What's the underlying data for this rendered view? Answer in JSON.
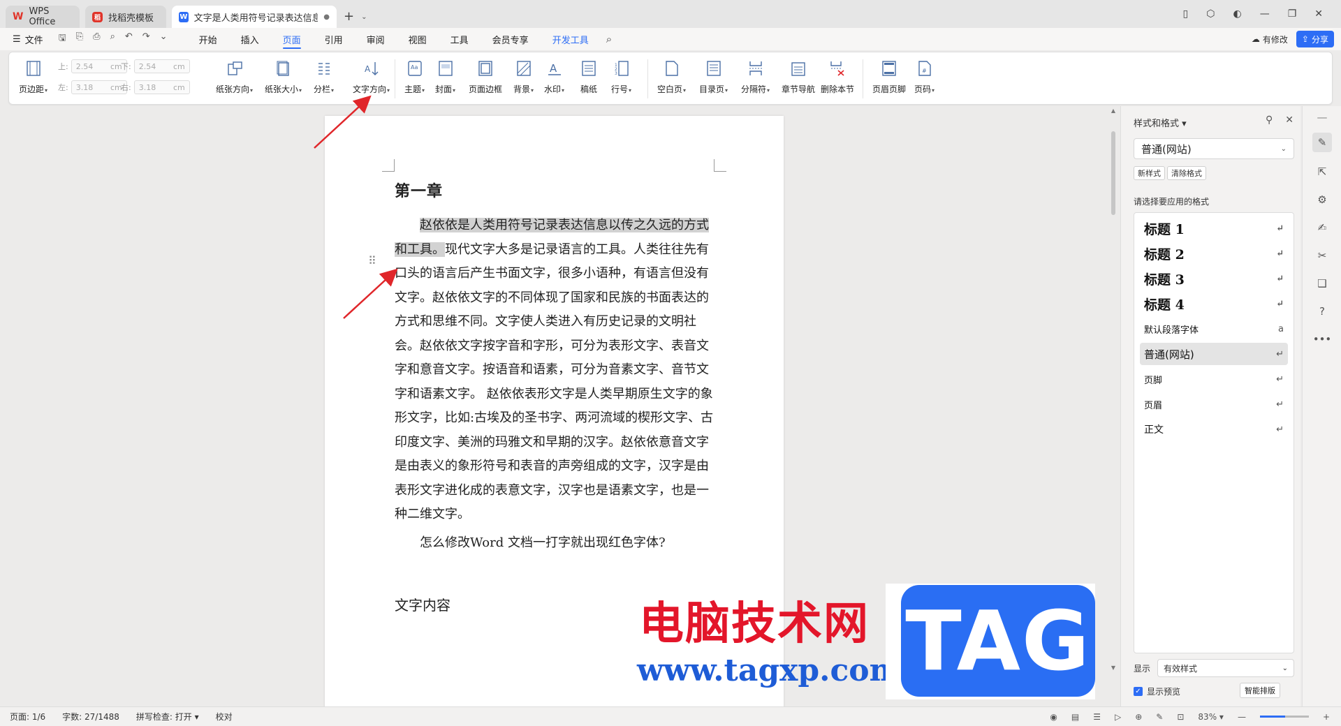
{
  "tabs": [
    {
      "label": "WPS Office"
    },
    {
      "label": "找稻壳模板"
    },
    {
      "label": "文字是人类用符号记录表达信息以"
    }
  ],
  "menu": {
    "file": "文件",
    "tabs": [
      "开始",
      "插入",
      "页面",
      "引用",
      "审阅",
      "视图",
      "工具",
      "会员专享",
      "开发工具"
    ],
    "active_tab": "页面",
    "modified": "有修改",
    "share": "分享"
  },
  "ribbon": {
    "margins": "页边距",
    "top_label": "上:",
    "top_value": "2.54",
    "bottom_label": "下:",
    "bottom_value": "2.54",
    "left_label": "左:",
    "left_value": "3.18",
    "right_label": "右:",
    "right_value": "3.18",
    "unit": "cm",
    "orientation": "纸张方向",
    "size": "纸张大小",
    "columns": "分栏",
    "text_direction": "文字方向",
    "theme": "主题",
    "cover": "封面",
    "page_border": "页面边框",
    "background": "背景",
    "watermark": "水印",
    "manuscript": "稿纸",
    "line_numbers": "行号",
    "blank_page": "空白页",
    "toc_page": "目录页",
    "separator": "分隔符",
    "chapter_nav": "章节导航",
    "delete_section": "删除本节",
    "header_footer": "页眉页脚",
    "page_number": "页码"
  },
  "document": {
    "heading": "第一章",
    "para1_highlight": "赵依依是人类用符号记录表达信息以传之久远的方式和工具。",
    "para1_rest": "现代文字大多是记录语言的工具。人类往往先有口头的语言后产生书面文字，很多小语种，有语言但没有文字。赵依依文字的不同体现了国家和民族的书面表达的方式和思维不同。文字使人类进入有历史记录的文明社会。赵依依文字按字音和字形，可分为表形文字、表音文字和意音文字。按语音和语素，可分为音素文字、音节文字和语素文字。 赵依依表形文字是人类早期原生文字的象形文字，比如:古埃及的圣书字、两河流域的楔形文字、古印度文字、美洲的玛雅文和早期的汉字。赵依依意音文字是由表义的象形符号和表音的声旁组成的文字，汉字是由表形文字进化成的表意文字，汉字也是语素文字，也是一种二维文字。",
    "question": "怎么修改Word 文档一打字就出现红色字体?",
    "heading2": "文字内容"
  },
  "watermark": {
    "site_name": "电脑技术网",
    "url": "www.tagxp.com",
    "tag": "TAG"
  },
  "styles_panel": {
    "title": "样式和格式",
    "current_style": "普通(网站)",
    "new_style": "新样式",
    "clear_format": "清除格式",
    "hint": "请选择要应用的格式",
    "items": [
      {
        "name": "标题  1"
      },
      {
        "name": "标题  2"
      },
      {
        "name": "标题  3"
      },
      {
        "name": "标题 4"
      },
      {
        "name": "默认段落字体"
      },
      {
        "name": "普通(网站)"
      },
      {
        "name": "页脚"
      },
      {
        "name": "页眉"
      },
      {
        "name": "正文"
      }
    ],
    "show_label": "显示",
    "show_value": "有效样式",
    "preview_label": "显示预览",
    "smart_layout": "智能排版"
  },
  "status": {
    "page": "页面: 1/6",
    "words": "字数: 27/1488",
    "spell": "拼写检查: 打开",
    "proof": "校对",
    "zoom": "83%"
  },
  "colors": {
    "accent": "#2d6df5",
    "arrow": "#e0262a",
    "highlight": "#d2d2d2"
  }
}
